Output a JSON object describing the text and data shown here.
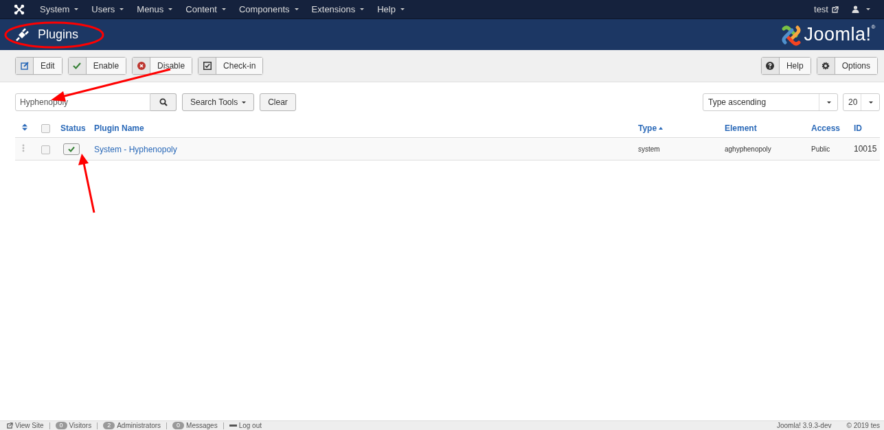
{
  "menu": {
    "items": [
      {
        "label": "System"
      },
      {
        "label": "Users"
      },
      {
        "label": "Menus"
      },
      {
        "label": "Content"
      },
      {
        "label": "Components"
      },
      {
        "label": "Extensions"
      },
      {
        "label": "Help"
      }
    ],
    "user": "test"
  },
  "header": {
    "title": "Plugins",
    "logo": "Joomla!$^{®}$"
  },
  "toolbar": {
    "left": [
      {
        "label": "Edit",
        "kind": "edit"
      },
      {
        "label": "Enable",
        "kind": "enable"
      },
      {
        "label": "Disable",
        "kind": "disable"
      },
      {
        "label": "Check-in",
        "kind": "checkin"
      }
    ],
    "right": [
      {
        "label": "Help",
        "kind": "help"
      },
      {
        "label": "Options",
        "kind": "options"
      }
    ]
  },
  "filters": {
    "search": {
      "value": "Hyphenopoly"
    },
    "search_tools": "Search Tools",
    "clear": "Clear",
    "ordering": "Type ascending",
    "limit": "20"
  },
  "table": {
    "columns": [
      {
        "label": "Status",
        "sorted": false
      },
      {
        "label": "Plugin Name",
        "sorted": false
      },
      {
        "label": "Type",
        "sorted": true
      },
      {
        "label": "Element",
        "sorted": false
      },
      {
        "label": "Access",
        "sorted": false
      },
      {
        "label": "ID",
        "sorted": false
      }
    ],
    "all_checked": false,
    "rows": [
      {
        "checked": false,
        "enabled": true,
        "name": "System - Hyphenopoly",
        "type": "system",
        "element": "aghyphenopoly",
        "access": "Public",
        "id": "10015"
      }
    ]
  },
  "status_bar": {
    "view_site": "View Site",
    "counters": [
      {
        "count": "0",
        "label": "Visitors"
      },
      {
        "count": "2",
        "label": "Administrators"
      },
      {
        "count": "0",
        "label": "Messages"
      }
    ],
    "logout": "Log out",
    "version": "Joomla! 3.9.3-dev",
    "copyright": "© 2019 tes"
  }
}
